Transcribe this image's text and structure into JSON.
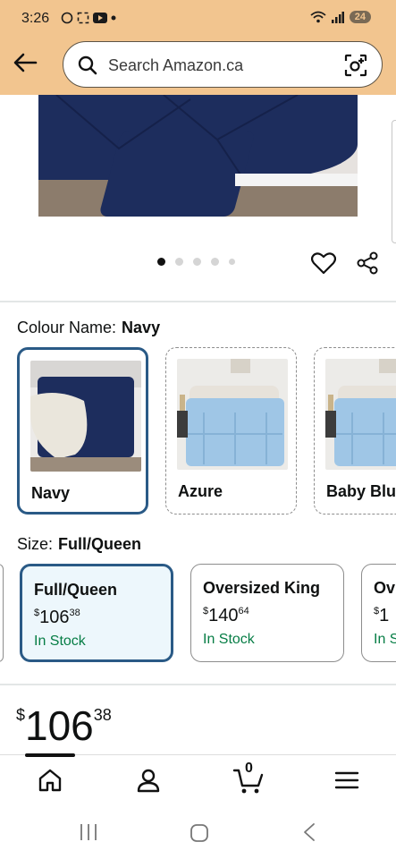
{
  "status": {
    "time": "3:26",
    "battery": "24"
  },
  "search": {
    "placeholder": "Search Amazon.ca"
  },
  "carousel": {
    "count": 5,
    "active_index": 0
  },
  "colour": {
    "label": "Colour Name:",
    "selected": "Navy",
    "options": [
      {
        "name": "Navy",
        "selected": true
      },
      {
        "name": "Azure",
        "selected": false
      },
      {
        "name": "Baby Blu",
        "selected": false
      }
    ]
  },
  "size": {
    "label": "Size:",
    "selected": "Full/Queen",
    "options": [
      {
        "name": "Full/Queen",
        "price_currency": "$",
        "price_whole": "106",
        "price_fraction": "38",
        "stock": "In Stock",
        "selected": true
      },
      {
        "name": "Oversized King",
        "price_currency": "$",
        "price_whole": "140",
        "price_fraction": "64",
        "stock": "In Stock",
        "selected": false
      },
      {
        "name": "Ov",
        "price_currency": "$",
        "price_whole": "1",
        "price_fraction": "",
        "stock": "In S",
        "selected": false
      }
    ]
  },
  "price": {
    "currency": "$",
    "whole": "106",
    "fraction": "38"
  },
  "bottom_nav": {
    "cart_count": "0",
    "items": [
      "home-icon",
      "account-icon",
      "cart-icon",
      "menu-icon"
    ]
  },
  "colors": {
    "header": "#f2c58f",
    "selected_border": "#2a5a86",
    "in_stock": "#067d45",
    "navy": "#1d2d5d",
    "azure": "#9fc6e6"
  }
}
